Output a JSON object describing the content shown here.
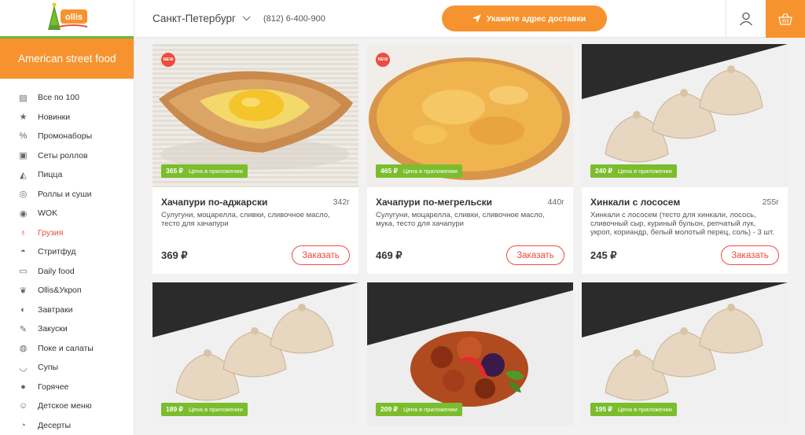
{
  "logo": {
    "text": "ollis"
  },
  "sidebar": {
    "promo": "American street food",
    "items": [
      {
        "label": "Все по 100",
        "icon": "stack-icon"
      },
      {
        "label": "Новинки",
        "icon": "star-icon"
      },
      {
        "label": "Промонаборы",
        "icon": "percent-icon"
      },
      {
        "label": "Сеты роллов",
        "icon": "rolls-set-icon"
      },
      {
        "label": "Пицца",
        "icon": "pizza-icon"
      },
      {
        "label": "Роллы и суши",
        "icon": "sushi-icon"
      },
      {
        "label": "WOK",
        "icon": "wok-icon"
      },
      {
        "label": "Грузия",
        "icon": "khinkali-icon",
        "active": true
      },
      {
        "label": "Стритфуд",
        "icon": "burger-icon"
      },
      {
        "label": "Daily food",
        "icon": "lunchbox-icon"
      },
      {
        "label": "Ollis&Укроп",
        "icon": "leaf-icon"
      },
      {
        "label": "Завтраки",
        "icon": "breakfast-icon"
      },
      {
        "label": "Закуски",
        "icon": "snack-icon"
      },
      {
        "label": "Поке и салаты",
        "icon": "salad-icon"
      },
      {
        "label": "Супы",
        "icon": "soup-icon"
      },
      {
        "label": "Горячее",
        "icon": "drumstick-icon"
      },
      {
        "label": "Детское меню",
        "icon": "kids-icon"
      },
      {
        "label": "Десерты",
        "icon": "dessert-icon"
      }
    ]
  },
  "header": {
    "city": "Санкт-Петербург",
    "phone": "(812) 6-400-900",
    "address_button": "Укажите адрес доставки"
  },
  "colors": {
    "accent": "#f7932e",
    "red": "#ef4b3f",
    "green": "#7bbd2d"
  },
  "products": [
    {
      "title": "Хачапури по-аджарски",
      "weight": "342г",
      "desc": "Сулугуни, моцарелла, сливки, сливочное масло, тесто для хачапури",
      "price": "369 ₽",
      "app_price": "365 ₽",
      "app_label": "Цена в приложении",
      "new": "NEW",
      "order": "Заказать",
      "image": "khachapuri-adjarian"
    },
    {
      "title": "Хачапури по-мегрельски",
      "weight": "440г",
      "desc": "Сулугуни, моцарелла, сливки, сливочное масло, мука, тесто для хачапури",
      "price": "469 ₽",
      "app_price": "465 ₽",
      "app_label": "Цена в приложении",
      "new": "NEW",
      "order": "Заказать",
      "image": "khachapuri-megrelian"
    },
    {
      "title": "Хинкали с лососем",
      "weight": "255г",
      "desc": "Хинкали с лососем (тесто для хинкали, лосось, сливочный сыр, куриный бульон, репчатый лук, укроп, кориандр, белый молотый перец, соль) - 3 шт.",
      "price": "245 ₽",
      "app_price": "240 ₽",
      "app_label": "Цена в приложении",
      "order": "Заказать",
      "image": "khinkali"
    },
    {
      "app_price": "189 ₽",
      "app_label": "Цена в приложении",
      "image": "khinkali"
    },
    {
      "app_price": "209 ₽",
      "app_label": "Цена в приложении",
      "image": "stew"
    },
    {
      "app_price": "195 ₽",
      "app_label": "Цена в приложении",
      "image": "khinkali"
    }
  ]
}
